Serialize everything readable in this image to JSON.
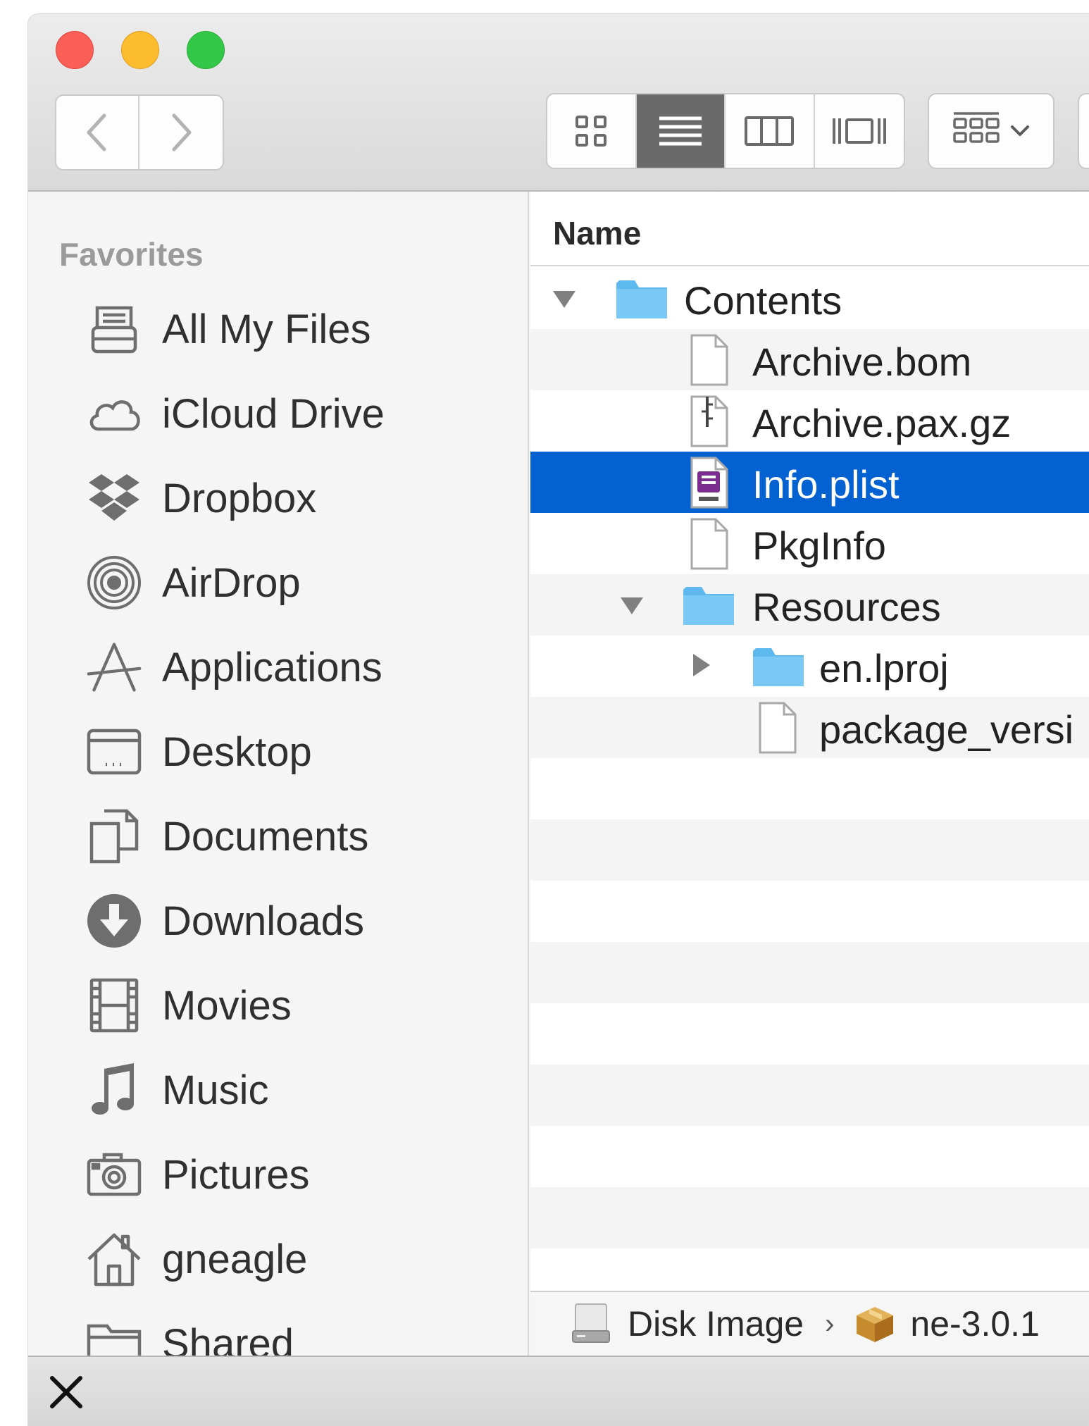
{
  "window": {
    "traffic_lights": [
      "close",
      "minimize",
      "zoom"
    ]
  },
  "toolbar": {
    "nav": [
      "back",
      "forward"
    ],
    "views": [
      "icon-view",
      "list-view",
      "column-view",
      "cover-flow-view"
    ],
    "active_view": "list-view",
    "arrange": "arrange-menu"
  },
  "sidebar": {
    "header": "Favorites",
    "items": [
      {
        "label": "All My Files",
        "icon": "all-my-files-icon"
      },
      {
        "label": "iCloud Drive",
        "icon": "icloud-drive-icon"
      },
      {
        "label": "Dropbox",
        "icon": "dropbox-icon"
      },
      {
        "label": "AirDrop",
        "icon": "airdrop-icon"
      },
      {
        "label": "Applications",
        "icon": "applications-icon"
      },
      {
        "label": "Desktop",
        "icon": "desktop-icon"
      },
      {
        "label": "Documents",
        "icon": "documents-icon"
      },
      {
        "label": "Downloads",
        "icon": "downloads-icon"
      },
      {
        "label": "Movies",
        "icon": "movies-icon"
      },
      {
        "label": "Music",
        "icon": "music-icon"
      },
      {
        "label": "Pictures",
        "icon": "pictures-icon"
      },
      {
        "label": "gneagle",
        "icon": "home-icon"
      },
      {
        "label": "Shared",
        "icon": "shared-icon"
      }
    ]
  },
  "content": {
    "column_header": "Name",
    "rows": [
      {
        "label": "Contents",
        "type": "folder",
        "disclosure": "expanded"
      },
      {
        "label": "Archive.bom",
        "type": "file"
      },
      {
        "label": "Archive.pax.gz",
        "type": "archive"
      },
      {
        "label": "Info.plist",
        "type": "plist",
        "selected": true
      },
      {
        "label": "PkgInfo",
        "type": "file"
      },
      {
        "label": "Resources",
        "type": "folder",
        "disclosure": "expanded"
      },
      {
        "label": "en.lproj",
        "type": "folder",
        "disclosure": "collapsed"
      },
      {
        "label": "package_versi",
        "type": "file"
      }
    ]
  },
  "pathbar": {
    "disk": "Disk Image",
    "separator": "›",
    "package": "ne-3.0.1"
  },
  "colors": {
    "selection": "#0461d1",
    "folder": "#6cc4f4",
    "red": "#fc5f57",
    "yellow": "#fdbc2e",
    "green": "#33c748"
  }
}
